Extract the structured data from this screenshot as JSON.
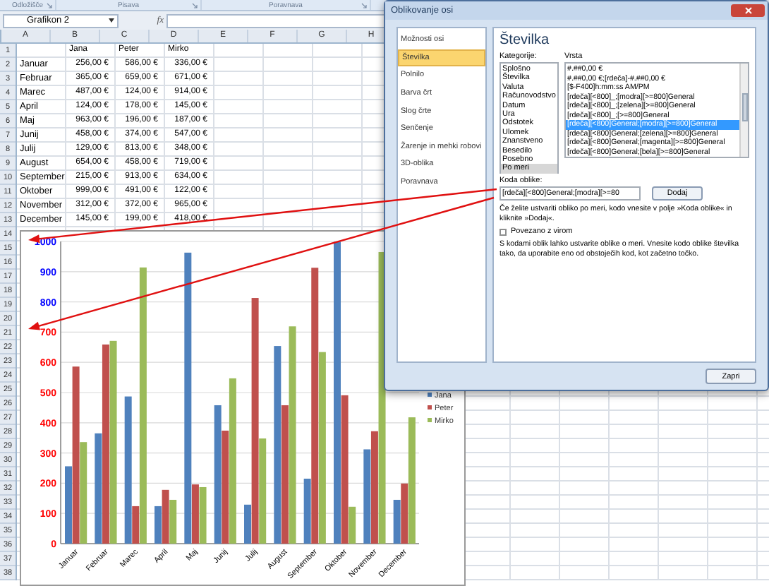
{
  "ribbon": {
    "groups": [
      {
        "label": "Odložišče"
      },
      {
        "label": "Pisava"
      },
      {
        "label": "Poravnava"
      }
    ]
  },
  "formula_bar": {
    "name_box": "Grafikon 2",
    "fx": "fx"
  },
  "sheet": {
    "column_headers": [
      "A",
      "B",
      "C",
      "D",
      "E",
      "F",
      "G",
      "H"
    ],
    "row_numbers": [
      "1",
      "2",
      "3",
      "4",
      "5",
      "6",
      "7",
      "8",
      "9",
      "10",
      "11",
      "12",
      "13",
      "14",
      "15",
      "16",
      "17",
      "18",
      "19",
      "20",
      "21",
      "22",
      "23",
      "24",
      "25",
      "26",
      "27",
      "28",
      "29",
      "30",
      "31",
      "32",
      "33",
      "34",
      "35",
      "36",
      "37",
      "38"
    ],
    "series_headers": [
      "Jana",
      "Peter",
      "Mirko"
    ],
    "rows": [
      {
        "label": "Januar",
        "values": [
          "256,00 €",
          "586,00 €",
          "336,00 €"
        ]
      },
      {
        "label": "Februar",
        "values": [
          "365,00 €",
          "659,00 €",
          "671,00 €"
        ]
      },
      {
        "label": "Marec",
        "values": [
          "487,00 €",
          "124,00 €",
          "914,00 €"
        ]
      },
      {
        "label": "April",
        "values": [
          "124,00 €",
          "178,00 €",
          "145,00 €"
        ]
      },
      {
        "label": "Maj",
        "values": [
          "963,00 €",
          "196,00 €",
          "187,00 €"
        ]
      },
      {
        "label": "Junij",
        "values": [
          "458,00 €",
          "374,00 €",
          "547,00 €"
        ]
      },
      {
        "label": "Julij",
        "values": [
          "129,00 €",
          "813,00 €",
          "348,00 €"
        ]
      },
      {
        "label": "August",
        "values": [
          "654,00 €",
          "458,00 €",
          "719,00 €"
        ]
      },
      {
        "label": "September",
        "values": [
          "215,00 €",
          "913,00 €",
          "634,00 €"
        ]
      },
      {
        "label": "Oktober",
        "values": [
          "999,00 €",
          "491,00 €",
          "122,00 €"
        ]
      },
      {
        "label": "November",
        "values": [
          "312,00 €",
          "372,00 €",
          "965,00 €"
        ]
      },
      {
        "label": "December",
        "values": [
          "145,00 €",
          "199,00 €",
          "418,00 €"
        ]
      }
    ]
  },
  "chart": {
    "chart_data": {
      "type": "bar",
      "categories": [
        "Januar",
        "Februar",
        "Marec",
        "April",
        "Maj",
        "Junij",
        "Julij",
        "August",
        "September",
        "Oktober",
        "November",
        "December"
      ],
      "series": [
        {
          "name": "Jana",
          "color": "#4f81bd",
          "values": [
            256,
            365,
            487,
            124,
            963,
            458,
            129,
            654,
            215,
            999,
            312,
            145
          ]
        },
        {
          "name": "Peter",
          "color": "#c0504d",
          "values": [
            586,
            659,
            124,
            178,
            196,
            374,
            813,
            458,
            913,
            491,
            372,
            199
          ]
        },
        {
          "name": "Mirko",
          "color": "#9bbb59",
          "values": [
            336,
            671,
            914,
            145,
            187,
            547,
            348,
            719,
            634,
            122,
            965,
            418
          ]
        }
      ],
      "ylim": [
        0,
        1000
      ],
      "yticks": [
        1000,
        900,
        800,
        700,
        600,
        500,
        400,
        300,
        200,
        100,
        0
      ],
      "grid": true,
      "legend": true
    },
    "y_axis_labels": [
      {
        "text": "1000",
        "color": "#0000ff"
      },
      {
        "text": "900",
        "color": "#0000ff"
      },
      {
        "text": "800",
        "color": "#0000ff"
      },
      {
        "text": "700",
        "color": "#ff0000"
      },
      {
        "text": "600",
        "color": "#ff0000"
      },
      {
        "text": "500",
        "color": "#ff0000"
      },
      {
        "text": "400",
        "color": "#ff0000"
      },
      {
        "text": "300",
        "color": "#ff0000"
      },
      {
        "text": "200",
        "color": "#ff0000"
      },
      {
        "text": "100",
        "color": "#ff0000"
      },
      {
        "text": "0",
        "color": "#ff0000"
      }
    ]
  },
  "dialog": {
    "title": "Oblikovanje osi",
    "nav": [
      {
        "label": "Možnosti osi",
        "selected": false
      },
      {
        "label": "Številka",
        "selected": true
      },
      {
        "label": "Polnilo",
        "selected": false
      },
      {
        "label": "Barva črt",
        "selected": false
      },
      {
        "label": "Slog črte",
        "selected": false
      },
      {
        "label": "Senčenje",
        "selected": false
      },
      {
        "label": "Žarenje in mehki robovi",
        "selected": false
      },
      {
        "label": "3D-oblika",
        "selected": false
      },
      {
        "label": "Poravnava",
        "selected": false
      }
    ],
    "heading": "Številka",
    "categories_label": "Kategorije:",
    "categories": [
      {
        "label": "Splošno",
        "selected": false
      },
      {
        "label": "Številka",
        "selected": false
      },
      {
        "label": "Valuta",
        "selected": false
      },
      {
        "label": "Računovodstvo",
        "selected": false
      },
      {
        "label": "Datum",
        "selected": false
      },
      {
        "label": "Ura",
        "selected": false
      },
      {
        "label": "Odstotek",
        "selected": false
      },
      {
        "label": "Ulomek",
        "selected": false
      },
      {
        "label": "Znanstveno",
        "selected": false
      },
      {
        "label": "Besedilo",
        "selected": false
      },
      {
        "label": "Posebno",
        "selected": false
      },
      {
        "label": "Po meri",
        "selected": true
      }
    ],
    "type_label": "Vrsta",
    "types": [
      {
        "label": "#.##0,00 €",
        "selected": false
      },
      {
        "label": "#.##0,00 €;[rdeča]-#.##0,00 €",
        "selected": false
      },
      {
        "label": "[$-F400]h:mm:ss AM/PM",
        "selected": false
      },
      {
        "label": "[rdeča][<800]_;[modra][>=800]General",
        "selected": false
      },
      {
        "label": "[rdeča][<800]_;[zelena][>=800]General",
        "selected": false
      },
      {
        "label": "[rdeča][<800]_;[>=800]General",
        "selected": false
      },
      {
        "label": "[rdeča][<800]General;[modra][>=800]General",
        "selected": true
      },
      {
        "label": "[rdeča][<800]General;[zelena][>=800]General",
        "selected": false
      },
      {
        "label": "[rdeča][<800]General;[magenta][>=800]General",
        "selected": false
      },
      {
        "label": "[rdeča][<800]General;[bela][>=800]General",
        "selected": false
      }
    ],
    "code_label": "Koda oblike:",
    "code_value": "[rdeča][<800]General;[modra][>=80",
    "add_button": "Dodaj",
    "hint": "Če želite ustvariti obliko po meri, kodo vnesite v polje »Koda oblike« in kliknite »Dodaj«.",
    "linked": {
      "label": "Povezano z virom",
      "checked": false
    },
    "description": "S kodami oblik lahko ustvarite oblike o meri. Vnesite kodo oblike številka tako, da uporabite eno od obstoječih kod, kot začetno točko.",
    "close_button": "Zapri"
  }
}
